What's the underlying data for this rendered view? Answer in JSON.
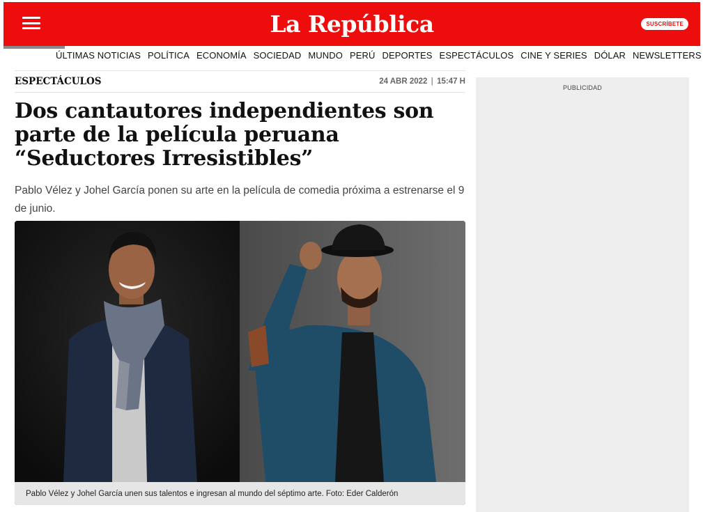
{
  "header": {
    "logo": "La República",
    "subscribe_label": "SUSCRÍBETE",
    "brand_color": "#ee0d0d"
  },
  "nav": {
    "items": [
      "ÚLTIMAS NOTICIAS",
      "POLÍTICA",
      "ECONOMÍA",
      "SOCIEDAD",
      "MUNDO",
      "PERÚ",
      "DEPORTES",
      "ESPECTÁCULOS",
      "CINE Y SERIES",
      "DÓLAR",
      "NEWSLETTERS"
    ]
  },
  "article": {
    "section": "ESPECTÁCULOS",
    "date": "24 ABR 2022",
    "separator": "|",
    "time": "15:47 H",
    "headline": "Dos cantautores independientes son parte de la película peruana “Seductores Irresistibles”",
    "summary": "Pablo Vélez y Johel García ponen su arte en la película de comedia próxima a estrenarse el 9 de junio.",
    "photo_caption": "Pablo Vélez y Johel García unen sus talentos e ingresan al mundo del séptimo arte. Foto: Eder Calderón"
  },
  "ad": {
    "label": "PUBLICIDAD"
  },
  "icons": {
    "menu": "hamburger-menu-icon"
  }
}
